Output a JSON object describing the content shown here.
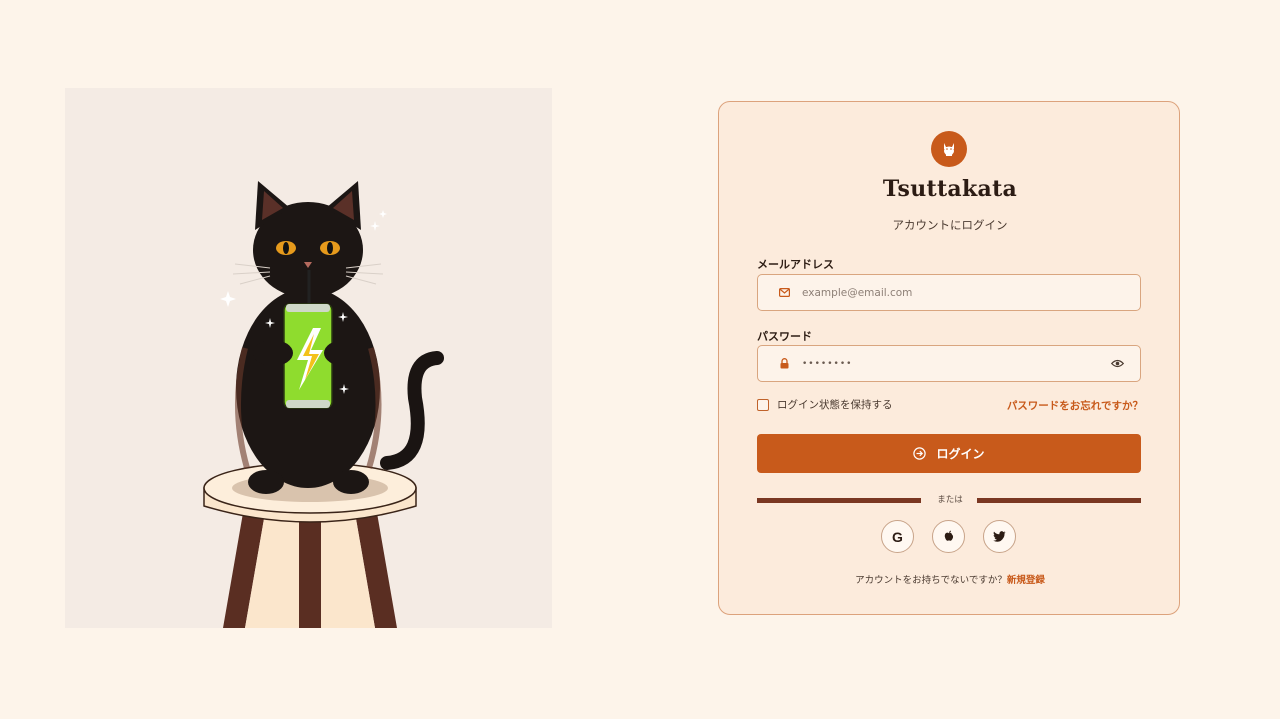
{
  "brand": {
    "name": "Tsuttakata",
    "subtitle": "アカウントにログイン",
    "accent_color": "#c85a1b",
    "logo_icon": "cat-icon"
  },
  "form": {
    "email": {
      "label": "メールアドレス",
      "placeholder": "example@email.com",
      "icon": "mail-icon"
    },
    "password": {
      "label": "パスワード",
      "value": "••••••••",
      "icon": "lock-icon",
      "toggle_icon": "eye-icon"
    },
    "remember_label": "ログイン状態を保持する",
    "forgot_link": "パスワードをお忘れですか？",
    "submit_label": "ログイン",
    "submit_icon": "arrow-right-circle-icon"
  },
  "divider_text": "または",
  "social_logins": [
    {
      "provider": "Google",
      "icon": "google-icon"
    },
    {
      "provider": "Apple",
      "icon": "apple-icon"
    },
    {
      "provider": "Twitter",
      "icon": "twitter-icon"
    }
  ],
  "signup": {
    "prompt": "アカウントをお持ちでないですか？",
    "link": "新規登録"
  },
  "illustration": {
    "subject": "black cat sipping energy drink on stool",
    "can_color": "#8fdc2e",
    "stool_color": "#5a2e22"
  }
}
